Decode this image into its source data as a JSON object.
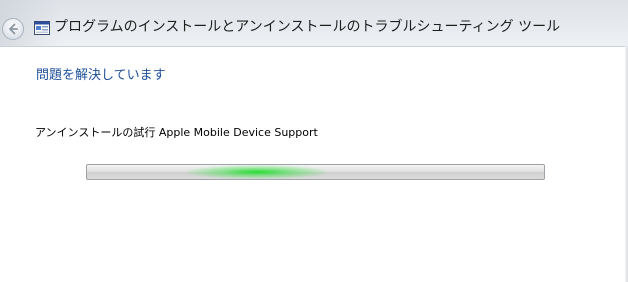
{
  "window": {
    "title": "プログラムのインストールとアンインストールのトラブルシューティング ツール"
  },
  "main": {
    "heading": "問題を解決しています",
    "status": "アンインストールの試行 Apple Mobile Device Support",
    "progress": {
      "mode": "indeterminate",
      "glow_color": "#22dd33"
    }
  },
  "icons": {
    "back": "back-arrow-icon",
    "app": "troubleshooter-app-icon"
  },
  "colors": {
    "heading": "#1f4f99",
    "text": "#000000",
    "titlebar": "#e3e7ec"
  }
}
